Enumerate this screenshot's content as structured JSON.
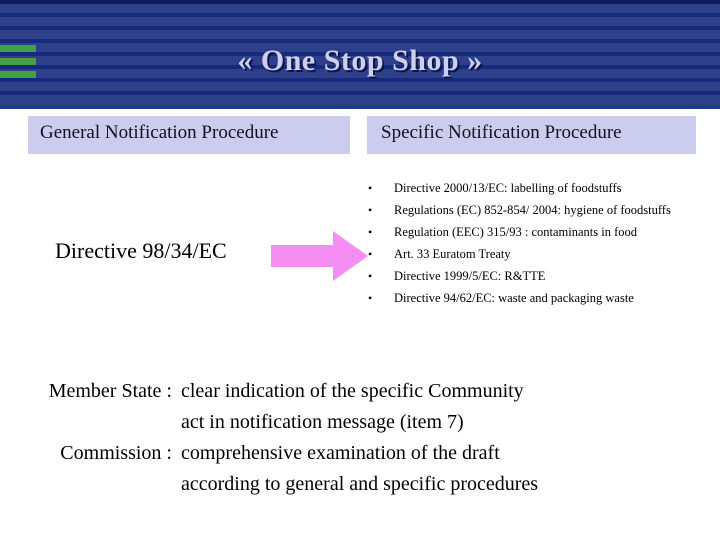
{
  "slide": {
    "title": "« One Stop Shop »",
    "header": {
      "stripes_base_color": "#16297a",
      "stripe_light_color": "#2e4089",
      "accent_bar_color": "#45a043",
      "title_color": "#ccd0ee"
    }
  },
  "procedures": {
    "general": {
      "heading": "General Notification Procedure",
      "box_color": "#ccccee",
      "directive": "Directive 98/34/EC",
      "arrow": {
        "icon": "right-arrow-icon",
        "color": "#f58ef2"
      }
    },
    "specific": {
      "heading": "Specific Notification Procedure",
      "box_color": "#ccccee",
      "acts": [
        "Directive 2000/13/EC: labelling of foodstuffs",
        "Regulations (EC) 852-854/ 2004: hygiene of foodstuffs",
        "Regulation (EEC) 315/93 : contaminants in food",
        "Art. 33 Euratom Treaty",
        "Directive 1999/5/EC: R&TTE",
        "Directive 94/62/EC: waste and packaging waste"
      ],
      "bullet_glyph": "•"
    }
  },
  "roles": [
    {
      "name": "Member State :",
      "lines": [
        "clear indication of the specific Community",
        "act in notification message (item 7)"
      ]
    },
    {
      "name": "Commission :",
      "lines": [
        "comprehensive examination of the draft",
        "according to general and specific procedures"
      ]
    }
  ]
}
